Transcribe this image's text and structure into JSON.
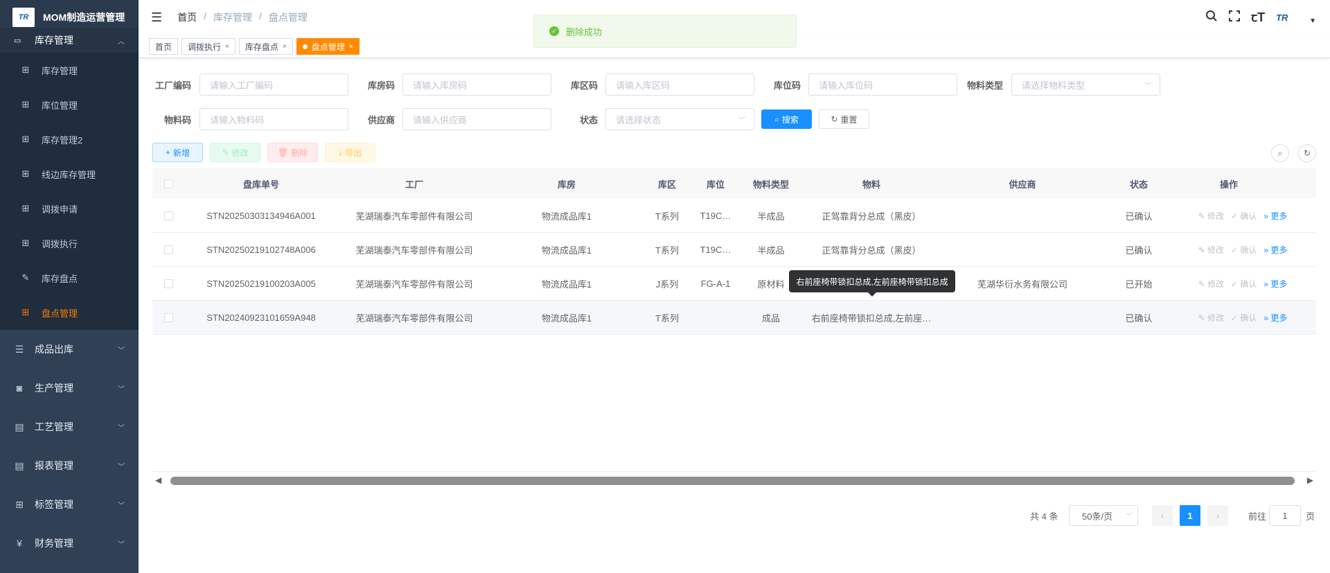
{
  "app": {
    "title": "MOM制造运营管理",
    "logo_text": "TR"
  },
  "sidebar": {
    "group": {
      "label": "库存管理"
    },
    "sub_items": [
      {
        "label": "库存管理"
      },
      {
        "label": "库位管理"
      },
      {
        "label": "库存管理2"
      },
      {
        "label": "线边库存管理"
      },
      {
        "label": "调拨申请"
      },
      {
        "label": "调拨执行"
      },
      {
        "label": "库存盘点"
      },
      {
        "label": "盘点管理"
      }
    ],
    "top_items": [
      {
        "label": "成品出库",
        "icon": "list-icon"
      },
      {
        "label": "生产管理",
        "icon": "production-icon"
      },
      {
        "label": "工艺管理",
        "icon": "process-icon"
      },
      {
        "label": "报表管理",
        "icon": "report-icon"
      },
      {
        "label": "标签管理",
        "icon": "label-icon"
      },
      {
        "label": "财务管理",
        "icon": "yen-icon"
      }
    ]
  },
  "header": {
    "breadcrumb": [
      "首页",
      "库存管理",
      "盘点管理"
    ],
    "avatar_text": "TR"
  },
  "tags": [
    {
      "label": "首页"
    },
    {
      "label": "调拨执行"
    },
    {
      "label": "库存盘点"
    },
    {
      "label": "盘点管理"
    }
  ],
  "toast": {
    "message": "删除成功"
  },
  "filters": {
    "factory_code": {
      "label": "工厂编码",
      "placeholder": "请输入工厂编码"
    },
    "warehouse_code": {
      "label": "库房码",
      "placeholder": "请输入库房码"
    },
    "area_code": {
      "label": "库区码",
      "placeholder": "请输入库区码"
    },
    "location_code": {
      "label": "库位码",
      "placeholder": "请输入库位码"
    },
    "material_type": {
      "label": "物料类型",
      "placeholder": "请选择物料类型"
    },
    "material_code": {
      "label": "物料码",
      "placeholder": "请输入物料码"
    },
    "supplier": {
      "label": "供应商",
      "placeholder": "请输入供应商"
    },
    "status": {
      "label": "状态",
      "placeholder": "请选择状态"
    },
    "search_label": "搜索",
    "reset_label": "重置"
  },
  "toolbar": {
    "add": "新增",
    "edit": "修改",
    "delete": "删除",
    "export": "导出"
  },
  "table": {
    "headers": {
      "no": "盘库单号",
      "factory": "工厂",
      "warehouse": "库房",
      "area": "库区",
      "location": "库位",
      "mtype": "物料类型",
      "material": "物料",
      "supplier": "供应商",
      "status": "状态",
      "ops": "操作"
    },
    "rows": [
      {
        "no": "STN20250303134946A001",
        "factory": "芜湖瑞泰汽车零部件有限公司",
        "warehouse": "物流成品库1",
        "area": "T系列",
        "location": "T19C…",
        "mtype": "半成品",
        "material": "正驾靠背分总成（黑皮）",
        "supplier": "",
        "status": "已确认"
      },
      {
        "no": "STN20250219102748A006",
        "factory": "芜湖瑞泰汽车零部件有限公司",
        "warehouse": "物流成品库1",
        "area": "T系列",
        "location": "T19C…",
        "mtype": "半成品",
        "material": "正驾靠背分总成（黑皮）",
        "supplier": "",
        "status": "已确认"
      },
      {
        "no": "STN20250219100203A005",
        "factory": "芜湖瑞泰汽车零部件有限公司",
        "warehouse": "物流成品库1",
        "area": "J系列",
        "location": "FG-A-1",
        "mtype": "原材料",
        "material": "",
        "supplier": "芜湖华衍水务有限公司",
        "status": "已开始"
      },
      {
        "no": "STN20240923101659A948",
        "factory": "芜湖瑞泰汽车零部件有限公司",
        "warehouse": "物流成品库1",
        "area": "T系列",
        "location": "",
        "mtype": "成品",
        "material": "右前座椅带锁扣总成,左前座…",
        "supplier": "",
        "status": "已确认"
      }
    ],
    "op_edit": "修改",
    "op_confirm": "确认",
    "op_more": "更多"
  },
  "tooltip": {
    "text": "右前座椅带锁扣总成,左前座椅带锁扣总成"
  },
  "pagination": {
    "total": "共 4 条",
    "page_size": "50条/页",
    "current": "1",
    "goto_label": "前往",
    "goto_value": "1",
    "page_unit": "页"
  }
}
